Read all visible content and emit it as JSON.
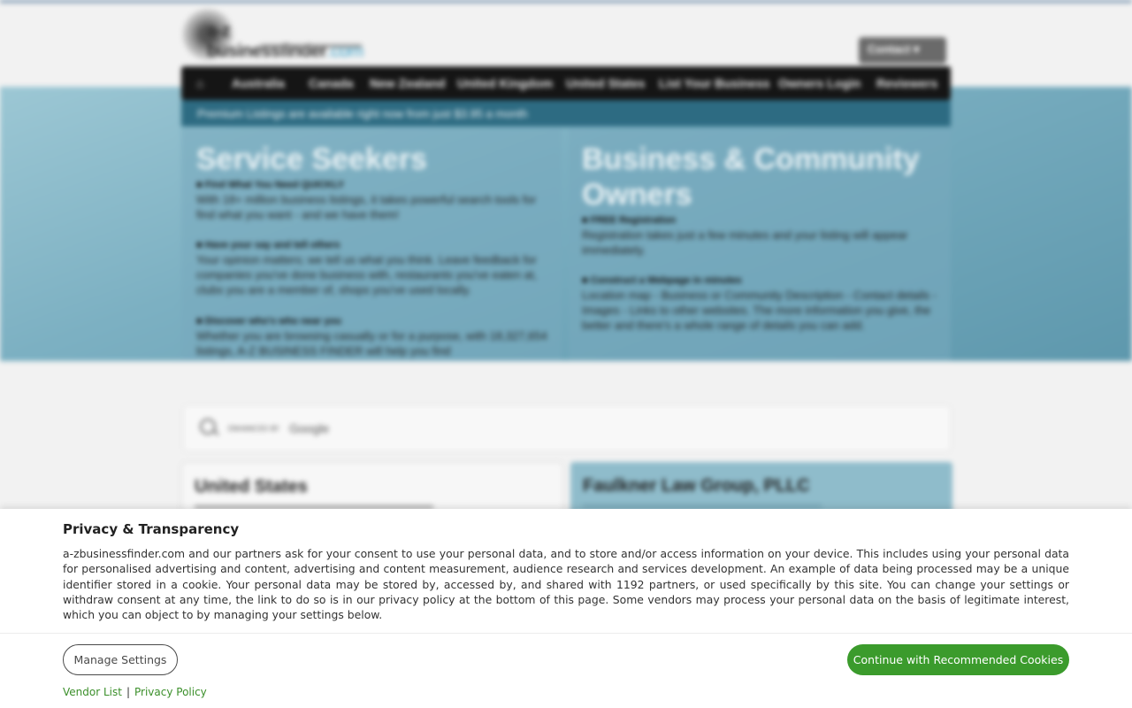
{
  "site": {
    "logo": {
      "text": "a-z businessfinder",
      "domain": ".com"
    },
    "contact_label": "Contact",
    "nav": {
      "home_icon": "home-icon",
      "items": [
        "Australia",
        "Canada",
        "New Zealand",
        "United Kingdom",
        "United States",
        "List Your Business",
        "Owners Login",
        "Reviewers"
      ]
    },
    "banner": "Premium Listings are available right now from just $3.95 a month",
    "left": {
      "title": "Service Seekers",
      "sections": [
        {
          "heading": "Find What You Need QUICKLY",
          "text": "With 18+ million business listings, it takes powerful search tools for find what you want - and we have them!"
        },
        {
          "heading": "Have your say and tell others",
          "text": "Your opinion matters; we tell us what you think. Leave feedback for companies you've done business with, restaurants you've eaten at, clubs you are a member of, shops you've used locally."
        },
        {
          "heading": "Discover who's who near you",
          "text": "Whether you are browsing casually or for a purpose, with 18,327,654 listings, A-Z BUSINESS FINDER will help you find"
        }
      ]
    },
    "right": {
      "title": "Business & Community Owners",
      "sections": [
        {
          "heading": "FREE Registration",
          "text": "Registration takes just a few minutes and your listing will appear immediately."
        },
        {
          "heading": "Construct a Webpage in minutes",
          "text": "Location map - Business or Community Description - Contact details - Images - Links to other websites. The more information you give, the better and there's a whole range of details you can add."
        }
      ]
    },
    "search": {
      "enhanced_by": "ENHANCED BY",
      "provider": "Google"
    },
    "cards": [
      {
        "title": "United States"
      },
      {
        "title": "Faulkner Law Group, PLLC"
      }
    ]
  },
  "consent": {
    "title": "Privacy & Transparency",
    "body": "a-zbusinessfinder.com and our partners ask for your consent to use your personal data, and to store and/or access information on your device. This includes using your personal data for personalised advertising and content, advertising and content measurement, audience research and services development. An example of data being processed may be a unique identifier stored in a cookie. Your personal data may be stored by, accessed by, and shared with 1192 partners, or used specifically by this site. You can change your settings or withdraw consent at any time, the link to do so is in our privacy policy at the bottom of this page. Some vendors may process your personal data on the basis of legitimate interest, which you can object to by managing your settings below.",
    "manage_label": "Manage Settings",
    "continue_label": "Continue with Recommended Cookies",
    "vendor_link": "Vendor List",
    "separator": "|",
    "privacy_link": "Privacy Policy",
    "colors": {
      "accent": "#3b9b2c",
      "link": "#3b8f2a"
    }
  }
}
